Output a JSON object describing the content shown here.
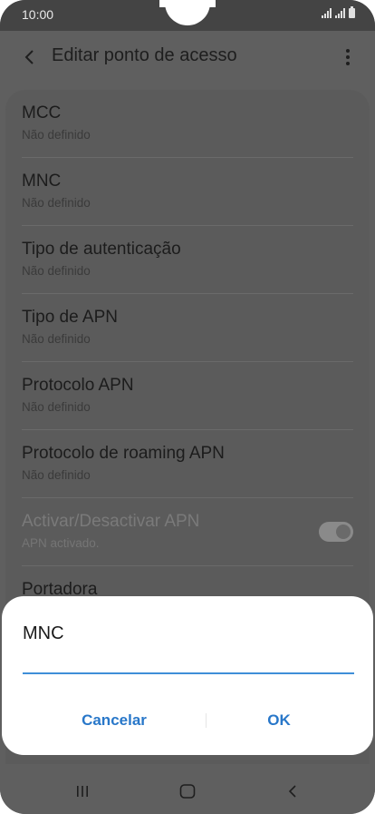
{
  "status_bar": {
    "time": "10:00"
  },
  "app_bar": {
    "title": "Editar ponto de acesso"
  },
  "settings": [
    {
      "title": "MCC",
      "subtitle": "Não definido"
    },
    {
      "title": "MNC",
      "subtitle": "Não definido"
    },
    {
      "title": "Tipo de autenticação",
      "subtitle": "Não definido"
    },
    {
      "title": "Tipo de APN",
      "subtitle": "Não definido"
    },
    {
      "title": "Protocolo APN",
      "subtitle": "Não definido"
    },
    {
      "title": "Protocolo de roaming APN",
      "subtitle": "Não definido"
    },
    {
      "title": "Activar/Desactivar APN",
      "subtitle": "APN activado.",
      "toggle_on": true,
      "disabled": true
    },
    {
      "title": "Portadora",
      "subtitle": ""
    }
  ],
  "dialog": {
    "title": "MNC",
    "input_value": "",
    "cancel_label": "Cancelar",
    "ok_label": "OK"
  },
  "colors": {
    "accent": "#2877c9",
    "input_underline": "#3f8fd8",
    "scrim": "#5f5f5f"
  },
  "icons": {
    "back": "chevron-left-icon",
    "more": "more-vertical-icon",
    "recents": "recents-icon",
    "home": "home-icon",
    "nav_back": "nav-back-icon"
  }
}
